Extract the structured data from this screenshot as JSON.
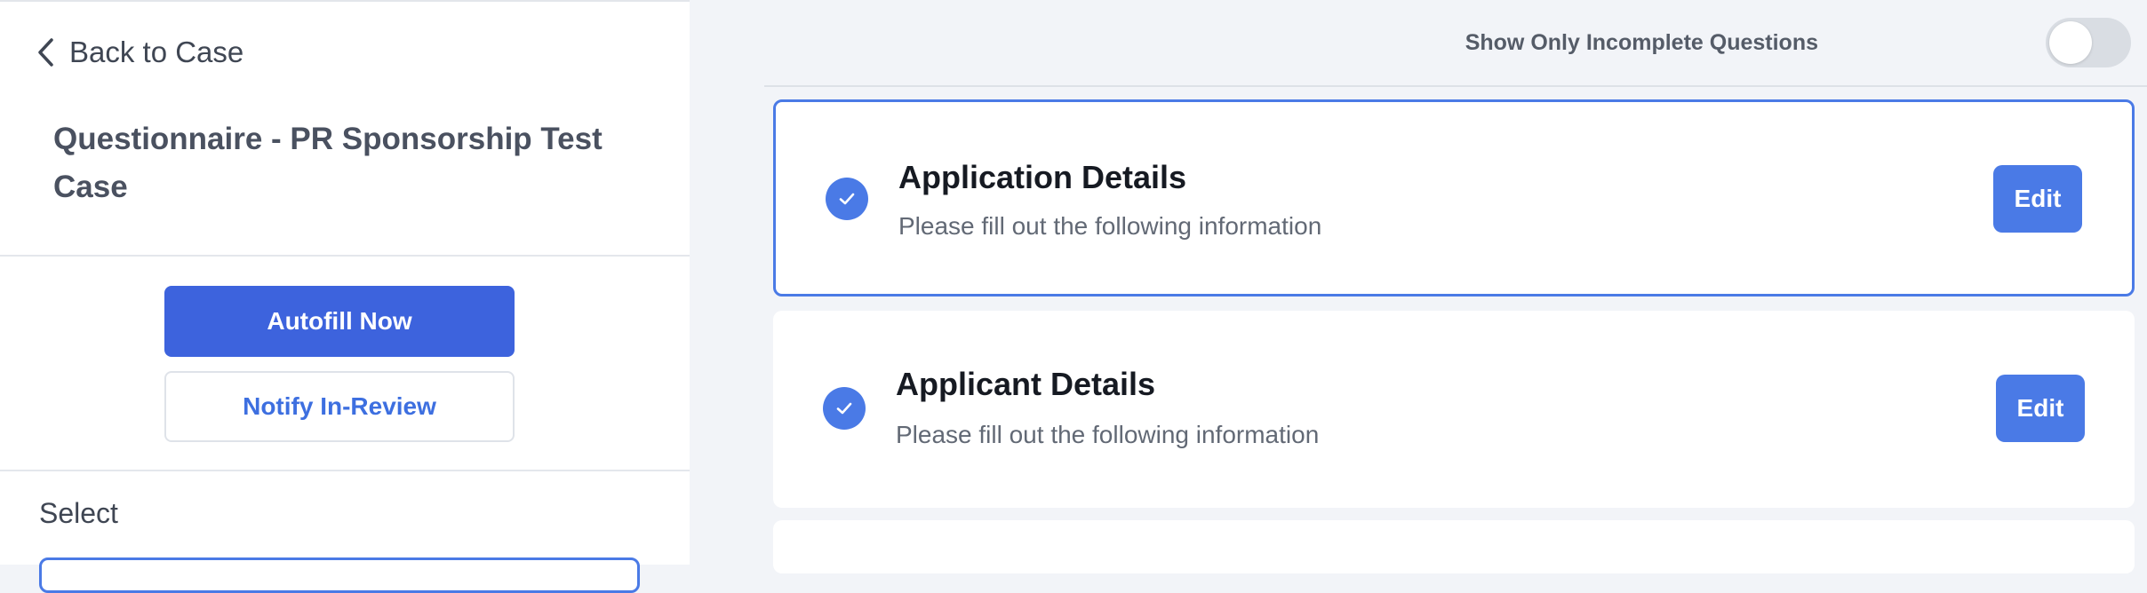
{
  "sidebar": {
    "back_label": "Back to Case",
    "title": "Questionnaire - PR Sponsorship Test Case",
    "autofill_label": "Autofill Now",
    "notify_label": "Notify In-Review",
    "select_label": "Select"
  },
  "main": {
    "toggle_label": "Show Only Incomplete Questions",
    "toggle_on": false,
    "sections": [
      {
        "title": "Application Details",
        "subtitle": "Please fill out the following information",
        "edit_label": "Edit",
        "complete": true
      },
      {
        "title": "Applicant Details",
        "subtitle": "Please fill out the following information",
        "edit_label": "Edit",
        "complete": true
      }
    ]
  },
  "colors": {
    "primary": "#3d63dd",
    "accent": "#4a7ae6",
    "background": "#f2f4f8"
  }
}
